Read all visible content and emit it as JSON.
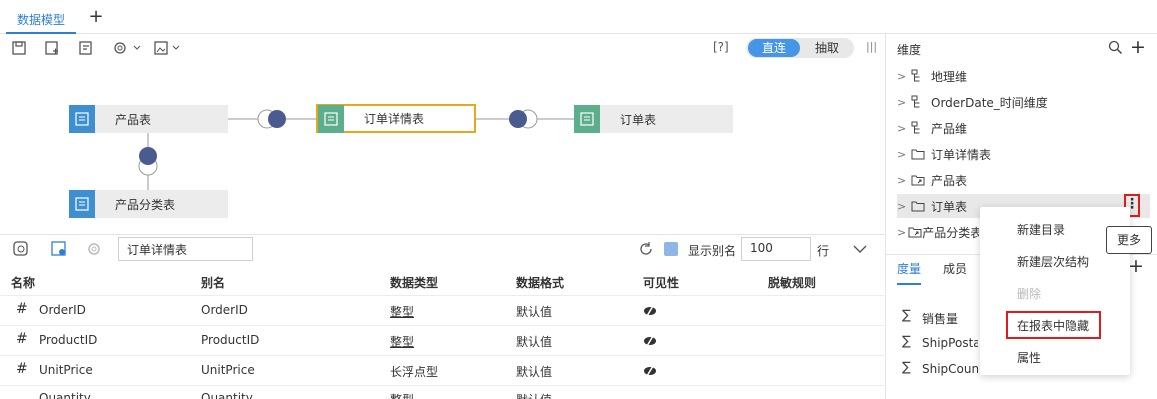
{
  "tabs": {
    "active": "数据模型",
    "add": "+"
  },
  "toolbar": {
    "help": "[?]",
    "mode_direct": "直连",
    "mode_extract": "抽取"
  },
  "diagram": {
    "nodes": {
      "product": "产品表",
      "order_detail": "订单详情表",
      "order": "订单表",
      "product_category": "产品分类表"
    }
  },
  "grid": {
    "search_value": "订单详情表",
    "show_alias_label": "显示别名",
    "row_count": "100",
    "rows_unit": "行",
    "headers": [
      "名称",
      "别名",
      "数据类型",
      "数据格式",
      "可见性",
      "脱敏规则"
    ],
    "rows": [
      {
        "name": "OrderID",
        "alias": "OrderID",
        "type": "整型",
        "format": "默认值"
      },
      {
        "name": "ProductID",
        "alias": "ProductID",
        "type": "整型",
        "format": "默认值"
      },
      {
        "name": "UnitPrice",
        "alias": "UnitPrice",
        "type": "长浮点型",
        "format": "默认值"
      },
      {
        "name": "Quantity",
        "alias": "Quantity",
        "type": "整型",
        "format": "默认值"
      }
    ]
  },
  "right_panel": {
    "title": "维度",
    "tree": [
      "地理维",
      "OrderDate_时间维度",
      "产品维",
      "订单详情表",
      "产品表",
      "订单表",
      "产品分类表"
    ],
    "tabs": {
      "measures": "度量",
      "members": "成员"
    },
    "measures": [
      "销售量",
      "ShipPostalCode",
      "ShipCountry"
    ],
    "sigma": "∑"
  },
  "context_menu": {
    "items": [
      "新建目录",
      "新建层次结构",
      "删除",
      "在报表中隐藏",
      "属性"
    ],
    "tooltip": "更多"
  },
  "colors": {
    "accent": "#2d7fd6",
    "highlight_box": "#e01b1b",
    "node_border": "#e6a817"
  }
}
